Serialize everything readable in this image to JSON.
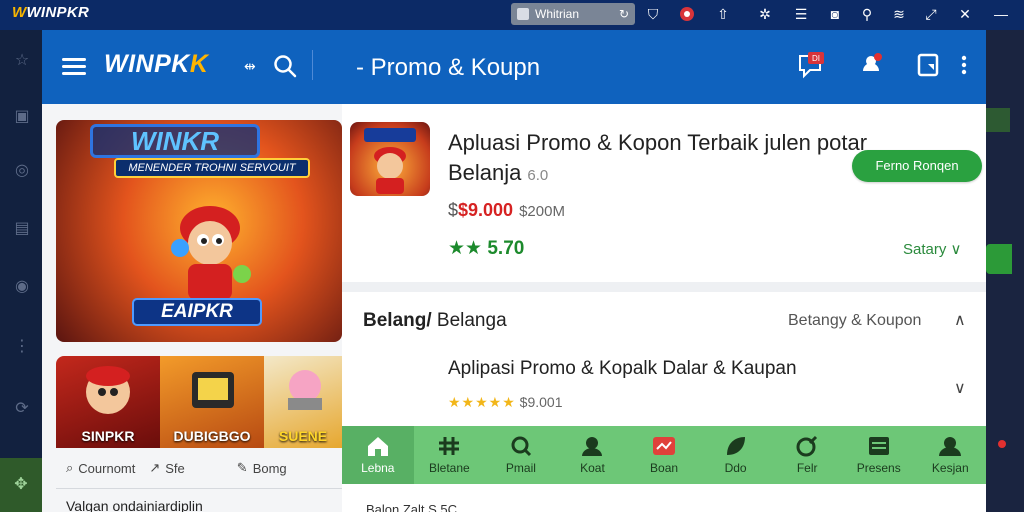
{
  "topbar": {
    "logo": "WINPKR",
    "tab_label": "Whitrian",
    "icons": [
      "shield-icon",
      "notification-icon",
      "upload-icon",
      "settings-icon",
      "document-icon",
      "camera-icon",
      "link-icon",
      "wifi-icon",
      "expand-icon",
      "close-icon"
    ]
  },
  "left_app": {
    "logo": "WINPK",
    "logo_accent": "K",
    "header_arrows": "⇹",
    "banner": {
      "title": "WINKR",
      "subtitle": "MENENDER TROHNI SERVOUIT",
      "footer": "EAIPKR"
    },
    "cards": [
      {
        "label": "SINPKR"
      },
      {
        "label": "DUBIGBGO"
      },
      {
        "label": "SUENE"
      }
    ],
    "row": {
      "item1": "Cournomt",
      "item2": "Sfe",
      "item3": "Bomg"
    },
    "footer_text": "Valgan ondainiardiplin"
  },
  "right_app": {
    "header_title": "- Promo & Koupn",
    "badge": "DI",
    "app": {
      "title": "Apluasi Promo & Kopon Terbaik julen potar Belanja",
      "meta": "6.0",
      "price": "$9.000",
      "price_prefix": "$",
      "price_old": "$200M",
      "rating": "★★ 5.70",
      "button": "Ferno Ronqen",
      "more": "Satary ∨"
    },
    "section": {
      "title_bold": "Belang/",
      "title": "Belanga",
      "right_label": "Betangy & Koupon",
      "item_title": "Aplipasi Promo & Kopalk Dalar & Kaupan",
      "item_stars": "★★★★★",
      "item_rating": "$9.001"
    },
    "nav": [
      {
        "label": "Lebna",
        "icon": "home-icon"
      },
      {
        "label": "Bletane",
        "icon": "grid-icon"
      },
      {
        "label": "Pmail",
        "icon": "search-icon"
      },
      {
        "label": "Koat",
        "icon": "user-icon"
      },
      {
        "label": "Boan",
        "icon": "chart-icon"
      },
      {
        "label": "Ddo",
        "icon": "leaf-icon"
      },
      {
        "label": "Felr",
        "icon": "target-icon"
      },
      {
        "label": "Presens",
        "icon": "list-icon"
      },
      {
        "label": "Kesjan",
        "icon": "profile-icon"
      }
    ],
    "below_text": "Balon   Zalt   S.5C"
  },
  "colors": {
    "header_blue": "#0f62be",
    "topbar_blue": "#0c2a66",
    "accent_green": "#2aa140",
    "nav_green": "#6dc777",
    "price_red": "#d62222"
  }
}
